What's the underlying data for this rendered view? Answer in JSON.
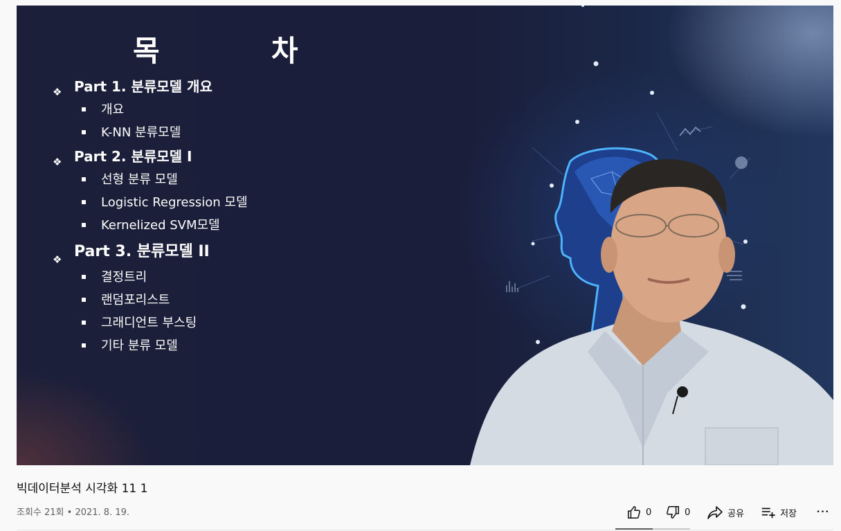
{
  "player": {
    "slide": {
      "title": "목  차",
      "parts": [
        {
          "label": "Part 1. 분류모델 개요",
          "items": [
            "개요",
            "K-NN 분류모델"
          ]
        },
        {
          "label": "Part 2. 분류모델 I",
          "items": [
            "선형 분류 모델",
            "Logistic Regression 모델",
            "Kernelized SVM모델"
          ]
        },
        {
          "label": "Part 3. 분류모델 II",
          "items": [
            "결정트리",
            "랜덤포리스트",
            "그래디언트 부스팅",
            "기타 분류 모델"
          ]
        }
      ]
    },
    "bullet_glyph": "❖"
  },
  "video": {
    "title": "빅데이터분석 시각화 11 1",
    "meta": "조회수 21회 • 2021. 8. 19."
  },
  "actions": {
    "like_count": "0",
    "dislike_count": "0",
    "share_label": "공유",
    "save_label": "저장",
    "more_glyph": "•••",
    "like_ratio": 0.5
  },
  "colors": {
    "page_bg": "#f9f9f9",
    "slide_bg": "#1c1f3a",
    "text_primary": "#0f0f0f",
    "text_secondary": "#606060"
  }
}
